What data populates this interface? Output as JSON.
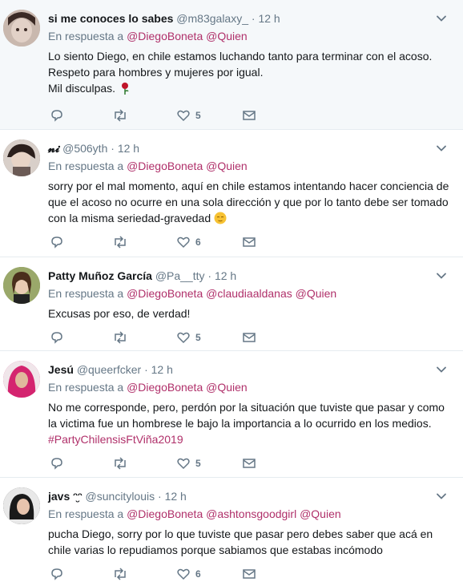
{
  "tweets": [
    {
      "name": "si me conoces lo sabes",
      "name_emoji": "",
      "handle": "@m83galaxy_",
      "time": "12 h",
      "reply_prefix": "En respuesta a",
      "mentions": [
        "@DiegoBoneta",
        "@Quien"
      ],
      "lines": [
        "Lo siento Diego, en chile estamos luchando tanto para terminar con el acoso.",
        "Respeto para hombres y mujeres por igual.",
        "Mil disculpas."
      ],
      "trailing_icon": "rose-icon",
      "hashtag": "",
      "likes": "5",
      "avatar_color": "#b8a49a"
    },
    {
      "name": "𝓷𝓲",
      "name_emoji": "",
      "handle": "@506yth",
      "time": "12 h",
      "reply_prefix": "En respuesta a",
      "mentions": [
        "@DiegoBoneta",
        "@Quien"
      ],
      "lines": [
        "sorry por el mal momento, aquí en chile estamos intentando hacer conciencia de",
        "que el acoso no ocurre en una sola dirección y que por lo tanto debe ser tomado",
        "con la misma seriedad-gravedad"
      ],
      "trailing_icon": "relieved-face-icon",
      "hashtag": "",
      "likes": "6",
      "avatar_color": "#6b5a55"
    },
    {
      "name": "Patty Muñoz García",
      "name_emoji": "",
      "handle": "@Pa__tty",
      "time": "12 h",
      "reply_prefix": "En respuesta a",
      "mentions": [
        "@DiegoBoneta",
        "@claudiaaldanas",
        "@Quien"
      ],
      "lines": [
        "Excusas por eso, de verdad!"
      ],
      "trailing_icon": "",
      "hashtag": "",
      "likes": "5",
      "avatar_color": "#7c8a4a"
    },
    {
      "name": "Jesú",
      "name_emoji": "",
      "handle": "@queerfcker",
      "time": "12 h",
      "reply_prefix": "En respuesta a",
      "mentions": [
        "@DiegoBoneta",
        "@Quien"
      ],
      "lines": [
        "No me corresponde, pero, perdón por la situación que tuviste que pasar y como",
        "la victima fue un hombrese le bajo la importancia a lo ocurrido en los medios."
      ],
      "trailing_icon": "",
      "hashtag": "#PartyChilensisFtViña2019",
      "likes": "5",
      "avatar_color": "#d4246f"
    },
    {
      "name": "javs",
      "name_emoji": "ᵔ̮ᵔ",
      "handle": "@suncitylouis",
      "time": "12 h",
      "reply_prefix": "En respuesta a",
      "mentions": [
        "@DiegoBoneta",
        "@ashtonsgoodgirl",
        "@Quien"
      ],
      "lines": [
        "pucha Diego, sorry por lo que tuviste que pasar pero debes saber que acá en",
        "chile varias lo repudiamos porque sabiamos que estabas incómodo"
      ],
      "trailing_icon": "",
      "hashtag": "",
      "likes": "6",
      "avatar_color": "#2a2a2a"
    }
  ],
  "colors": {
    "mention": "#b0306a",
    "muted": "#657786",
    "highlight_bg": "#f5f8fa"
  }
}
